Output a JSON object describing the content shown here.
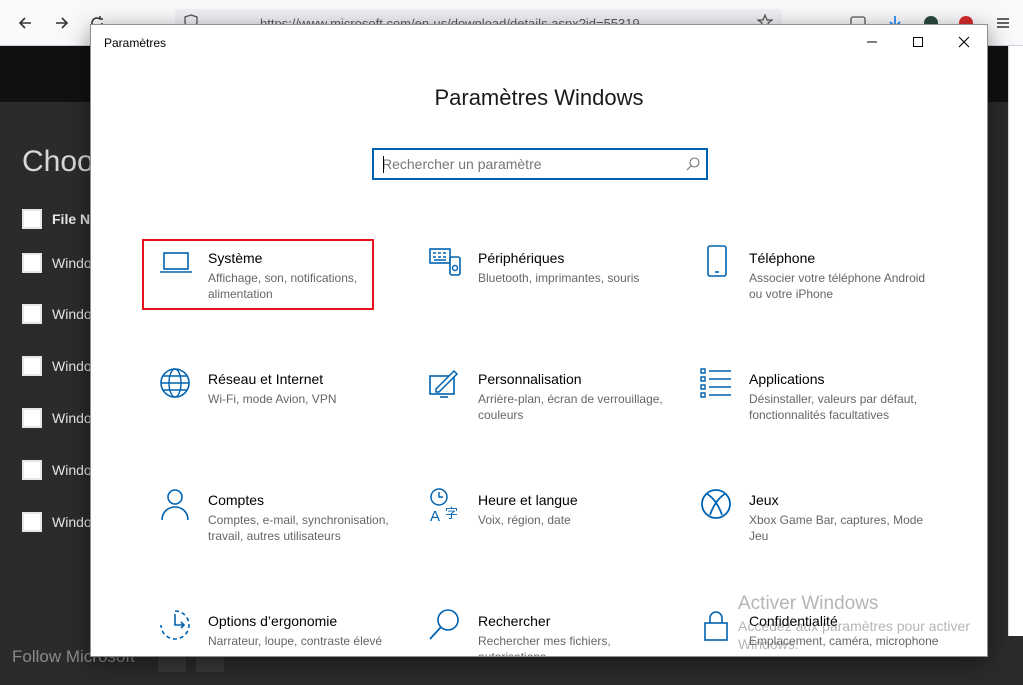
{
  "browser": {
    "url": "https://www.microsoft.com/en-us/download/details.aspx?id=55319"
  },
  "webpage": {
    "title": "Choo",
    "header_row_label": "File N",
    "rows": [
      "Windo",
      "Windo",
      "Windo",
      "Windo",
      "Windo",
      "Windo"
    ],
    "footer": "Follow Microsoft"
  },
  "window": {
    "title": "Paramètres",
    "heading": "Paramètres Windows",
    "search_placeholder": "Rechercher un paramètre"
  },
  "tiles": [
    {
      "icon": "laptop-icon",
      "title": "Système",
      "desc": "Affichage, son, notifications, alimentation"
    },
    {
      "icon": "devices-icon",
      "title": "Périphériques",
      "desc": "Bluetooth, imprimantes, souris"
    },
    {
      "icon": "phone-icon",
      "title": "Téléphone",
      "desc": "Associer votre téléphone Android ou votre iPhone"
    },
    {
      "icon": "globe-icon",
      "title": "Réseau et Internet",
      "desc": "Wi-Fi, mode Avion, VPN"
    },
    {
      "icon": "personalization-icon",
      "title": "Personnalisation",
      "desc": "Arrière-plan, écran de verrouillage, couleurs"
    },
    {
      "icon": "apps-icon",
      "title": "Applications",
      "desc": "Désinstaller, valeurs par défaut, fonctionnalités facultatives"
    },
    {
      "icon": "person-icon",
      "title": "Comptes",
      "desc": "Comptes, e-mail, synchronisation, travail, autres utilisateurs"
    },
    {
      "icon": "time-language-icon",
      "title": "Heure et langue",
      "desc": "Voix, région, date"
    },
    {
      "icon": "xbox-icon",
      "title": "Jeux",
      "desc": "Xbox Game Bar, captures, Mode Jeu"
    },
    {
      "icon": "ease-of-access-icon",
      "title": "Options d’ergonomie",
      "desc": "Narrateur, loupe, contraste élevé"
    },
    {
      "icon": "search-icon",
      "title": "Rechercher",
      "desc": "Rechercher mes fichiers, autorisations"
    },
    {
      "icon": "lock-icon",
      "title": "Confidentialité",
      "desc": "Emplacement, caméra, microphone"
    }
  ],
  "watermark": {
    "title": "Activer Windows",
    "subtitle": "Accédez aux paramètres pour activer Windows."
  },
  "colors": {
    "accent": "#0063b1",
    "highlight": "#e8121c"
  }
}
